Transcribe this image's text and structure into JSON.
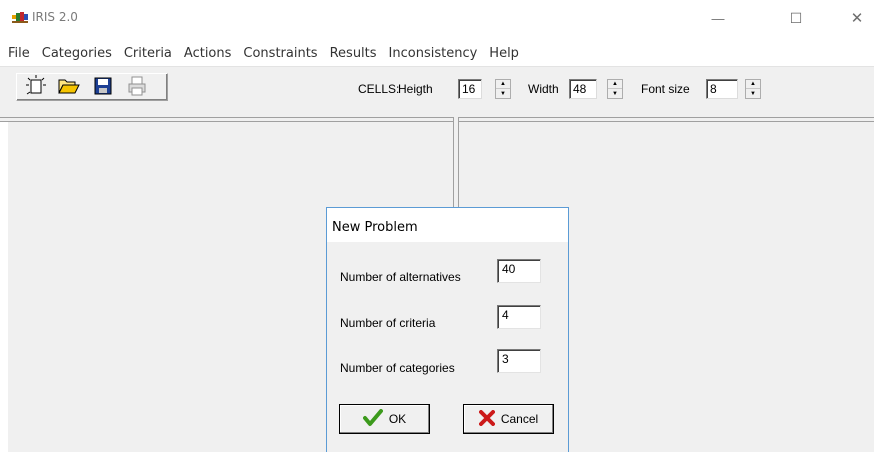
{
  "window": {
    "title": "IRIS 2.0",
    "controls": {
      "minimize": "—",
      "maximize": "☐",
      "close": "✕"
    }
  },
  "menu": [
    "File",
    "Categories",
    "Criteria",
    "Actions",
    "Constraints",
    "Results",
    "Inconsistency",
    "Help"
  ],
  "toolbar": {
    "buttons": [
      "new-icon",
      "open-folder-icon",
      "save-icon",
      "print-icon"
    ],
    "cells_label": "CELLS:",
    "height": {
      "label": "Heigth",
      "value": "16"
    },
    "width": {
      "label": "Width",
      "value": "48"
    },
    "font_size": {
      "label": "Font size",
      "value": "8"
    }
  },
  "dialog": {
    "title": "New Problem",
    "fields": [
      {
        "label": "Number of alternatives",
        "value": "40"
      },
      {
        "label": "Number of criteria",
        "value": "4"
      },
      {
        "label": "Number of categories",
        "value": "3"
      }
    ],
    "ok_label": "OK",
    "cancel_label": "Cancel"
  },
  "colors": {
    "dialog_border": "#5b9bd5",
    "ok_check": "#3c9a1c",
    "cancel_x": "#cc1a1a",
    "face": "#f0f0f0"
  }
}
